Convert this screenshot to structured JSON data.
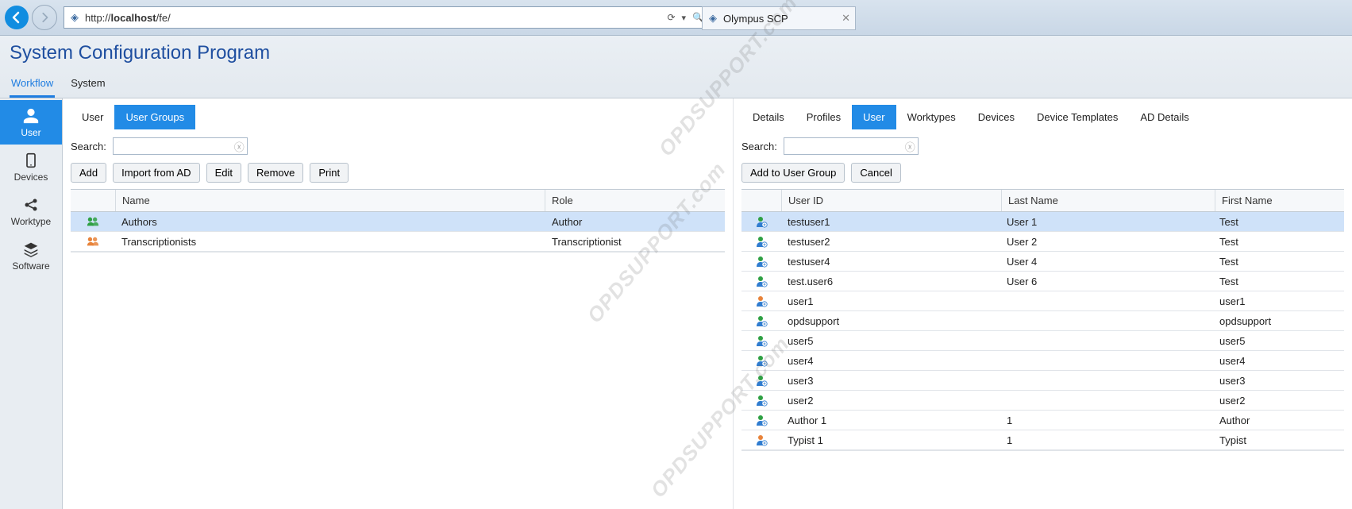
{
  "browser": {
    "url": "http://localhost/fe/",
    "tab_title": "Olympus SCP"
  },
  "app": {
    "title": "System Configuration Program"
  },
  "top_tabs": [
    {
      "label": "Workflow",
      "active": true
    },
    {
      "label": "System",
      "active": false
    }
  ],
  "sidebar": [
    {
      "label": "User",
      "icon": "user",
      "active": true
    },
    {
      "label": "Devices",
      "icon": "device",
      "active": false
    },
    {
      "label": "Worktype",
      "icon": "share",
      "active": false
    },
    {
      "label": "Software",
      "icon": "stack",
      "active": false
    }
  ],
  "left": {
    "sub_tabs": [
      {
        "label": "User",
        "active": false
      },
      {
        "label": "User Groups",
        "active": true
      }
    ],
    "search_label": "Search:",
    "buttons": [
      "Add",
      "Import from AD",
      "Edit",
      "Remove",
      "Print"
    ],
    "columns": [
      "",
      "Name",
      "Role"
    ],
    "rows": [
      {
        "name": "Authors",
        "role": "Author",
        "icon_color": "#2ea043",
        "selected": true
      },
      {
        "name": "Transcriptionists",
        "role": "Transcriptionist",
        "icon_color": "#e8833a",
        "selected": false
      }
    ]
  },
  "right": {
    "detail_tabs": [
      {
        "label": "Details",
        "active": false
      },
      {
        "label": "Profiles",
        "active": false
      },
      {
        "label": "User",
        "active": true
      },
      {
        "label": "Worktypes",
        "active": false
      },
      {
        "label": "Devices",
        "active": false
      },
      {
        "label": "Device Templates",
        "active": false
      },
      {
        "label": "AD Details",
        "active": false
      }
    ],
    "search_label": "Search:",
    "buttons": [
      "Add to User Group",
      "Cancel"
    ],
    "columns": [
      "",
      "User ID",
      "Last Name",
      "First Name"
    ],
    "rows": [
      {
        "user_id": "testuser1",
        "last_name": "User 1",
        "first_name": "Test",
        "icon": "green",
        "selected": true
      },
      {
        "user_id": "testuser2",
        "last_name": "User 2",
        "first_name": "Test",
        "icon": "green",
        "selected": false
      },
      {
        "user_id": "testuser4",
        "last_name": "User 4",
        "first_name": "Test",
        "icon": "green",
        "selected": false
      },
      {
        "user_id": "test.user6",
        "last_name": "User 6",
        "first_name": "Test",
        "icon": "green",
        "selected": false
      },
      {
        "user_id": "user1",
        "last_name": "",
        "first_name": "user1",
        "icon": "orange",
        "selected": false
      },
      {
        "user_id": "opdsupport",
        "last_name": "",
        "first_name": "opdsupport",
        "icon": "green",
        "selected": false
      },
      {
        "user_id": "user5",
        "last_name": "",
        "first_name": "user5",
        "icon": "green",
        "selected": false
      },
      {
        "user_id": "user4",
        "last_name": "",
        "first_name": "user4",
        "icon": "green",
        "selected": false
      },
      {
        "user_id": "user3",
        "last_name": "",
        "first_name": "user3",
        "icon": "green",
        "selected": false
      },
      {
        "user_id": "user2",
        "last_name": "",
        "first_name": "user2",
        "icon": "green",
        "selected": false
      },
      {
        "user_id": "Author 1",
        "last_name": "1",
        "first_name": "Author",
        "icon": "green",
        "selected": false
      },
      {
        "user_id": "Typist 1",
        "last_name": "1",
        "first_name": "Typist",
        "icon": "orange",
        "selected": false
      }
    ]
  },
  "watermark": "OPDSUPPORT.com"
}
